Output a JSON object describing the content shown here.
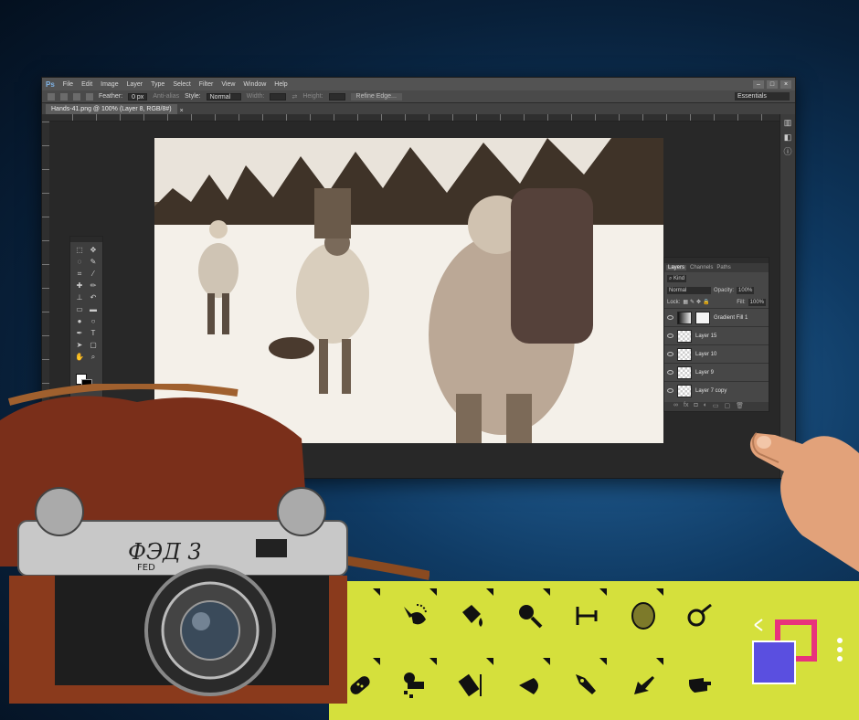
{
  "photoshop": {
    "logo": "Ps",
    "menu": [
      "File",
      "Edit",
      "Image",
      "Layer",
      "Type",
      "Select",
      "Filter",
      "View",
      "Window",
      "Help"
    ],
    "options": {
      "feather_label": "Feather:",
      "feather_value": "0 px",
      "antialias_label": "Anti-alias",
      "style_label": "Style:",
      "style_value": "Normal",
      "width_label": "Width:",
      "height_label": "Height:",
      "refine_edge": "Refine Edge...",
      "workspace": "Essentials"
    },
    "document_tab": "Hands-41.png @ 100% (Layer 8, RGB/8#)",
    "layers_panel": {
      "tabs": [
        "Layers",
        "Channels",
        "Paths"
      ],
      "kind": "Kind",
      "blend_mode": "Normal",
      "opacity_label": "Opacity:",
      "opacity_value": "100%",
      "lock_label": "Lock:",
      "fill_label": "Fill:",
      "fill_value": "100%",
      "layers": [
        "Gradient Fill 1",
        "Layer 15",
        "Layer 10",
        "Layer 9",
        "Layer 7 copy"
      ]
    }
  },
  "camera_brand": "ФЭД 3",
  "camera_brand_latin": "FED",
  "colors": {
    "accent_bar": "#d5e03c",
    "logo_pink": "#e8327c",
    "logo_blue": "#5a4fe0"
  },
  "bottom_tools": [
    "lasso-wand-icon",
    "fill-bucket-icon",
    "zoom-icon",
    "measure-icon",
    "color-ellipse-icon",
    "magnify-glass-icon",
    "bandage-icon",
    "clone-stamp-icon",
    "eraser-icon",
    "smudge-icon",
    "pen-nib-icon",
    "arrow-pointer-icon",
    "hand-glove-icon"
  ]
}
